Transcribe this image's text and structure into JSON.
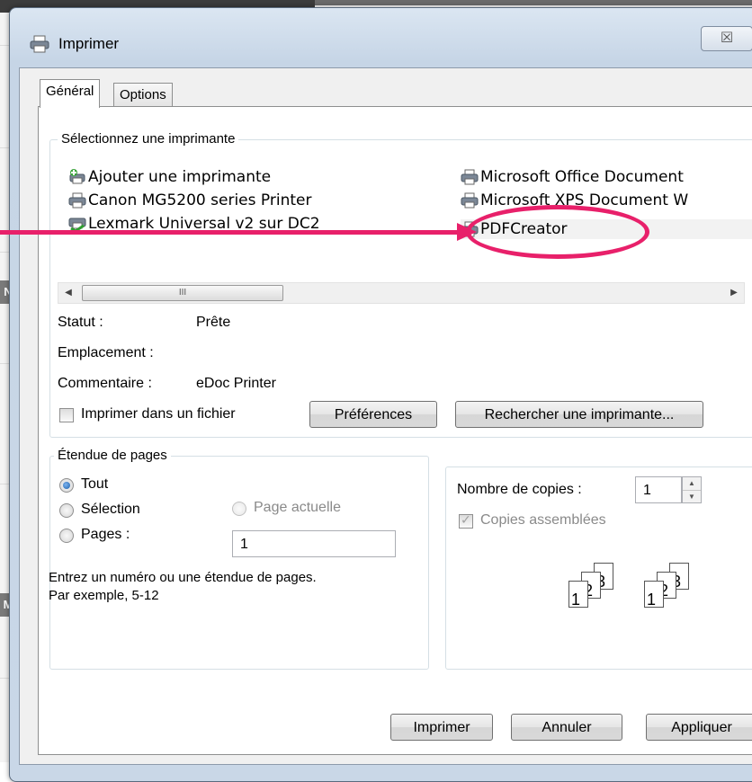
{
  "window": {
    "title": "Imprimer",
    "close_glyph": "☒"
  },
  "tabs": [
    {
      "label": "Général",
      "active": true
    },
    {
      "label": "Options",
      "active": false
    }
  ],
  "printer_group": {
    "title": "Sélectionnez une imprimante",
    "printers_left": [
      {
        "name": "Ajouter une imprimante",
        "icon": "add-printer-icon"
      },
      {
        "name": "Canon MG5200 series Printer",
        "icon": "printer-icon"
      },
      {
        "name": "Lexmark Universal v2 sur DC2",
        "icon": "network-printer-icon"
      }
    ],
    "printers_right": [
      {
        "name": "Microsoft Office Document",
        "icon": "printer-icon"
      },
      {
        "name": "Microsoft XPS Document W",
        "icon": "printer-icon"
      },
      {
        "name": "PDFCreator",
        "icon": "printer-icon",
        "selected": true
      }
    ],
    "scroll_left": "◀",
    "scroll_right": "▶",
    "scroll_grip": "III",
    "status_label": "Statut :",
    "status_value": "Prête",
    "location_label": "Emplacement :",
    "location_value": "",
    "comment_label": "Commentaire :",
    "comment_value": "eDoc Printer",
    "print_to_file_label": "Imprimer dans un fichier",
    "preferences_label": "Préférences",
    "find_printer_label": "Rechercher une imprimante..."
  },
  "page_range": {
    "title": "Étendue de pages",
    "all_label": "Tout",
    "selection_label": "Sélection",
    "current_page_label": "Page actuelle",
    "pages_label": "Pages :",
    "pages_value": "1",
    "hint_line1": "Entrez un numéro ou une étendue de pages.",
    "hint_line2": "Par exemple, 5-12"
  },
  "copies": {
    "count_label": "Nombre de copies :",
    "count_value": "1",
    "collate_label": "Copies assemblées",
    "collate_checked": true,
    "collate_disabled": true,
    "page_numbers": [
      "1",
      "2",
      "3"
    ]
  },
  "buttons": {
    "print_label": "Imprimer",
    "cancel_label": "Annuler",
    "apply_label": "Appliquer"
  },
  "background": {
    "badges": [
      "N",
      "M"
    ]
  },
  "colors": {
    "annotation": "#e8206a",
    "radio_selected": "#1a5ea8"
  }
}
